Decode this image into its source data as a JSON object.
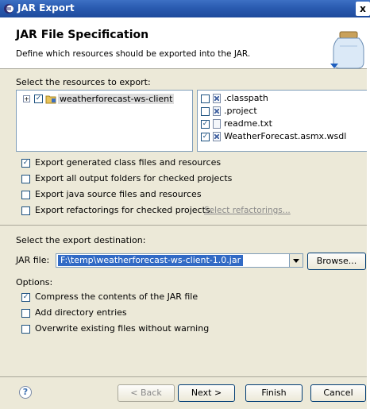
{
  "window": {
    "title": "JAR Export",
    "close_glyph": "x"
  },
  "header": {
    "title": "JAR File Specification",
    "description": "Define which resources should be exported into the JAR.",
    "icon": "jar-icon"
  },
  "resources": {
    "label": "Select the resources to export:",
    "tree": [
      {
        "label": "weatherforecast-ws-client",
        "checked": true,
        "expanded": false
      }
    ],
    "files": [
      {
        "label": ".classpath",
        "checked": false,
        "icon": "x-file-icon"
      },
      {
        "label": ".project",
        "checked": false,
        "icon": "x-file-icon"
      },
      {
        "label": "readme.txt",
        "checked": true,
        "icon": "text-file-icon"
      },
      {
        "label": "WeatherForecast.asmx.wsdl",
        "checked": true,
        "icon": "x-file-icon"
      }
    ]
  },
  "export_options": [
    {
      "label": "Export generated class files and resources",
      "checked": true
    },
    {
      "label": "Export all output folders for checked projects",
      "checked": false
    },
    {
      "label": "Export java source files and resources",
      "checked": false
    },
    {
      "label": "Export refactorings for checked projects.",
      "checked": false
    }
  ],
  "select_refactorings_link": "Select refactorings...",
  "destination": {
    "label": "Select the export destination:",
    "jar_file_label": "JAR file:",
    "jar_file_value": "F:\\temp\\weatherforecast-ws-client-1.0.jar",
    "browse_label": "Browse..."
  },
  "options": {
    "label": "Options:",
    "items": [
      {
        "label": "Compress the contents of the JAR file",
        "checked": true
      },
      {
        "label": "Add directory entries",
        "checked": false
      },
      {
        "label": "Overwrite existing files without warning",
        "checked": false
      }
    ]
  },
  "footer": {
    "help_glyph": "?",
    "back_label": "< Back",
    "next_label": "Next >",
    "finish_label": "Finish",
    "cancel_label": "Cancel"
  },
  "colors": {
    "titlebar": "#2a5bb0",
    "selection": "#316ac5",
    "dialog_bg": "#ece9d8"
  }
}
